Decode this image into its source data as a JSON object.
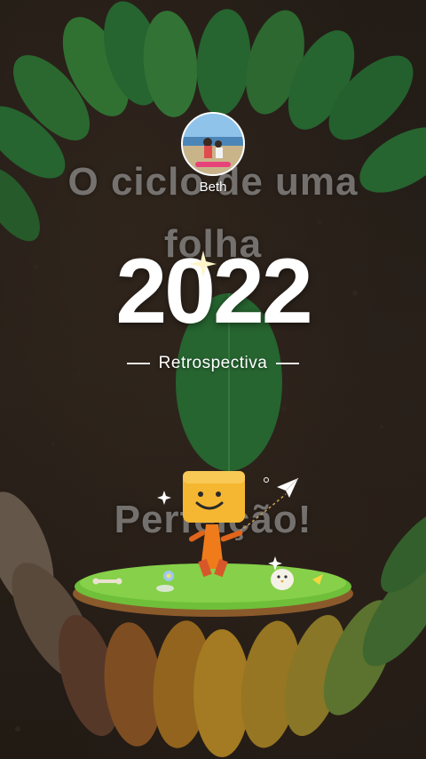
{
  "background_captions": [
    "O ciclo de uma",
    "folha",
    "Perfeição!"
  ],
  "profile": {
    "name": "Beth"
  },
  "hero": {
    "year": "2022",
    "subtitle": "Retrospectiva"
  },
  "colors": {
    "leaf_green": "#2f7a3b",
    "leaf_yellow": "#c8952a",
    "leaf_brown": "#7a5a40",
    "mascot_head": "#f5b731",
    "mascot_body": "#f07b1a",
    "grass": "#6fbf3a"
  }
}
